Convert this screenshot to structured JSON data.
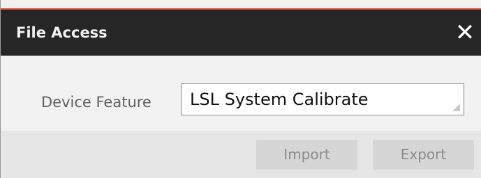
{
  "dialog": {
    "title": "File Access",
    "close_glyph": "✕",
    "close_icon": "close-icon"
  },
  "form": {
    "device_feature_label": "Device Feature",
    "device_feature_value": "LSL System Calibrate"
  },
  "footer": {
    "import_label": "Import",
    "export_label": "Export"
  },
  "colors": {
    "titlebar": "#262626",
    "accent": "#d9402a",
    "body": "#f2f2f2",
    "footer": "#e6e6e6",
    "button_disabled": "#d6d6d6"
  }
}
